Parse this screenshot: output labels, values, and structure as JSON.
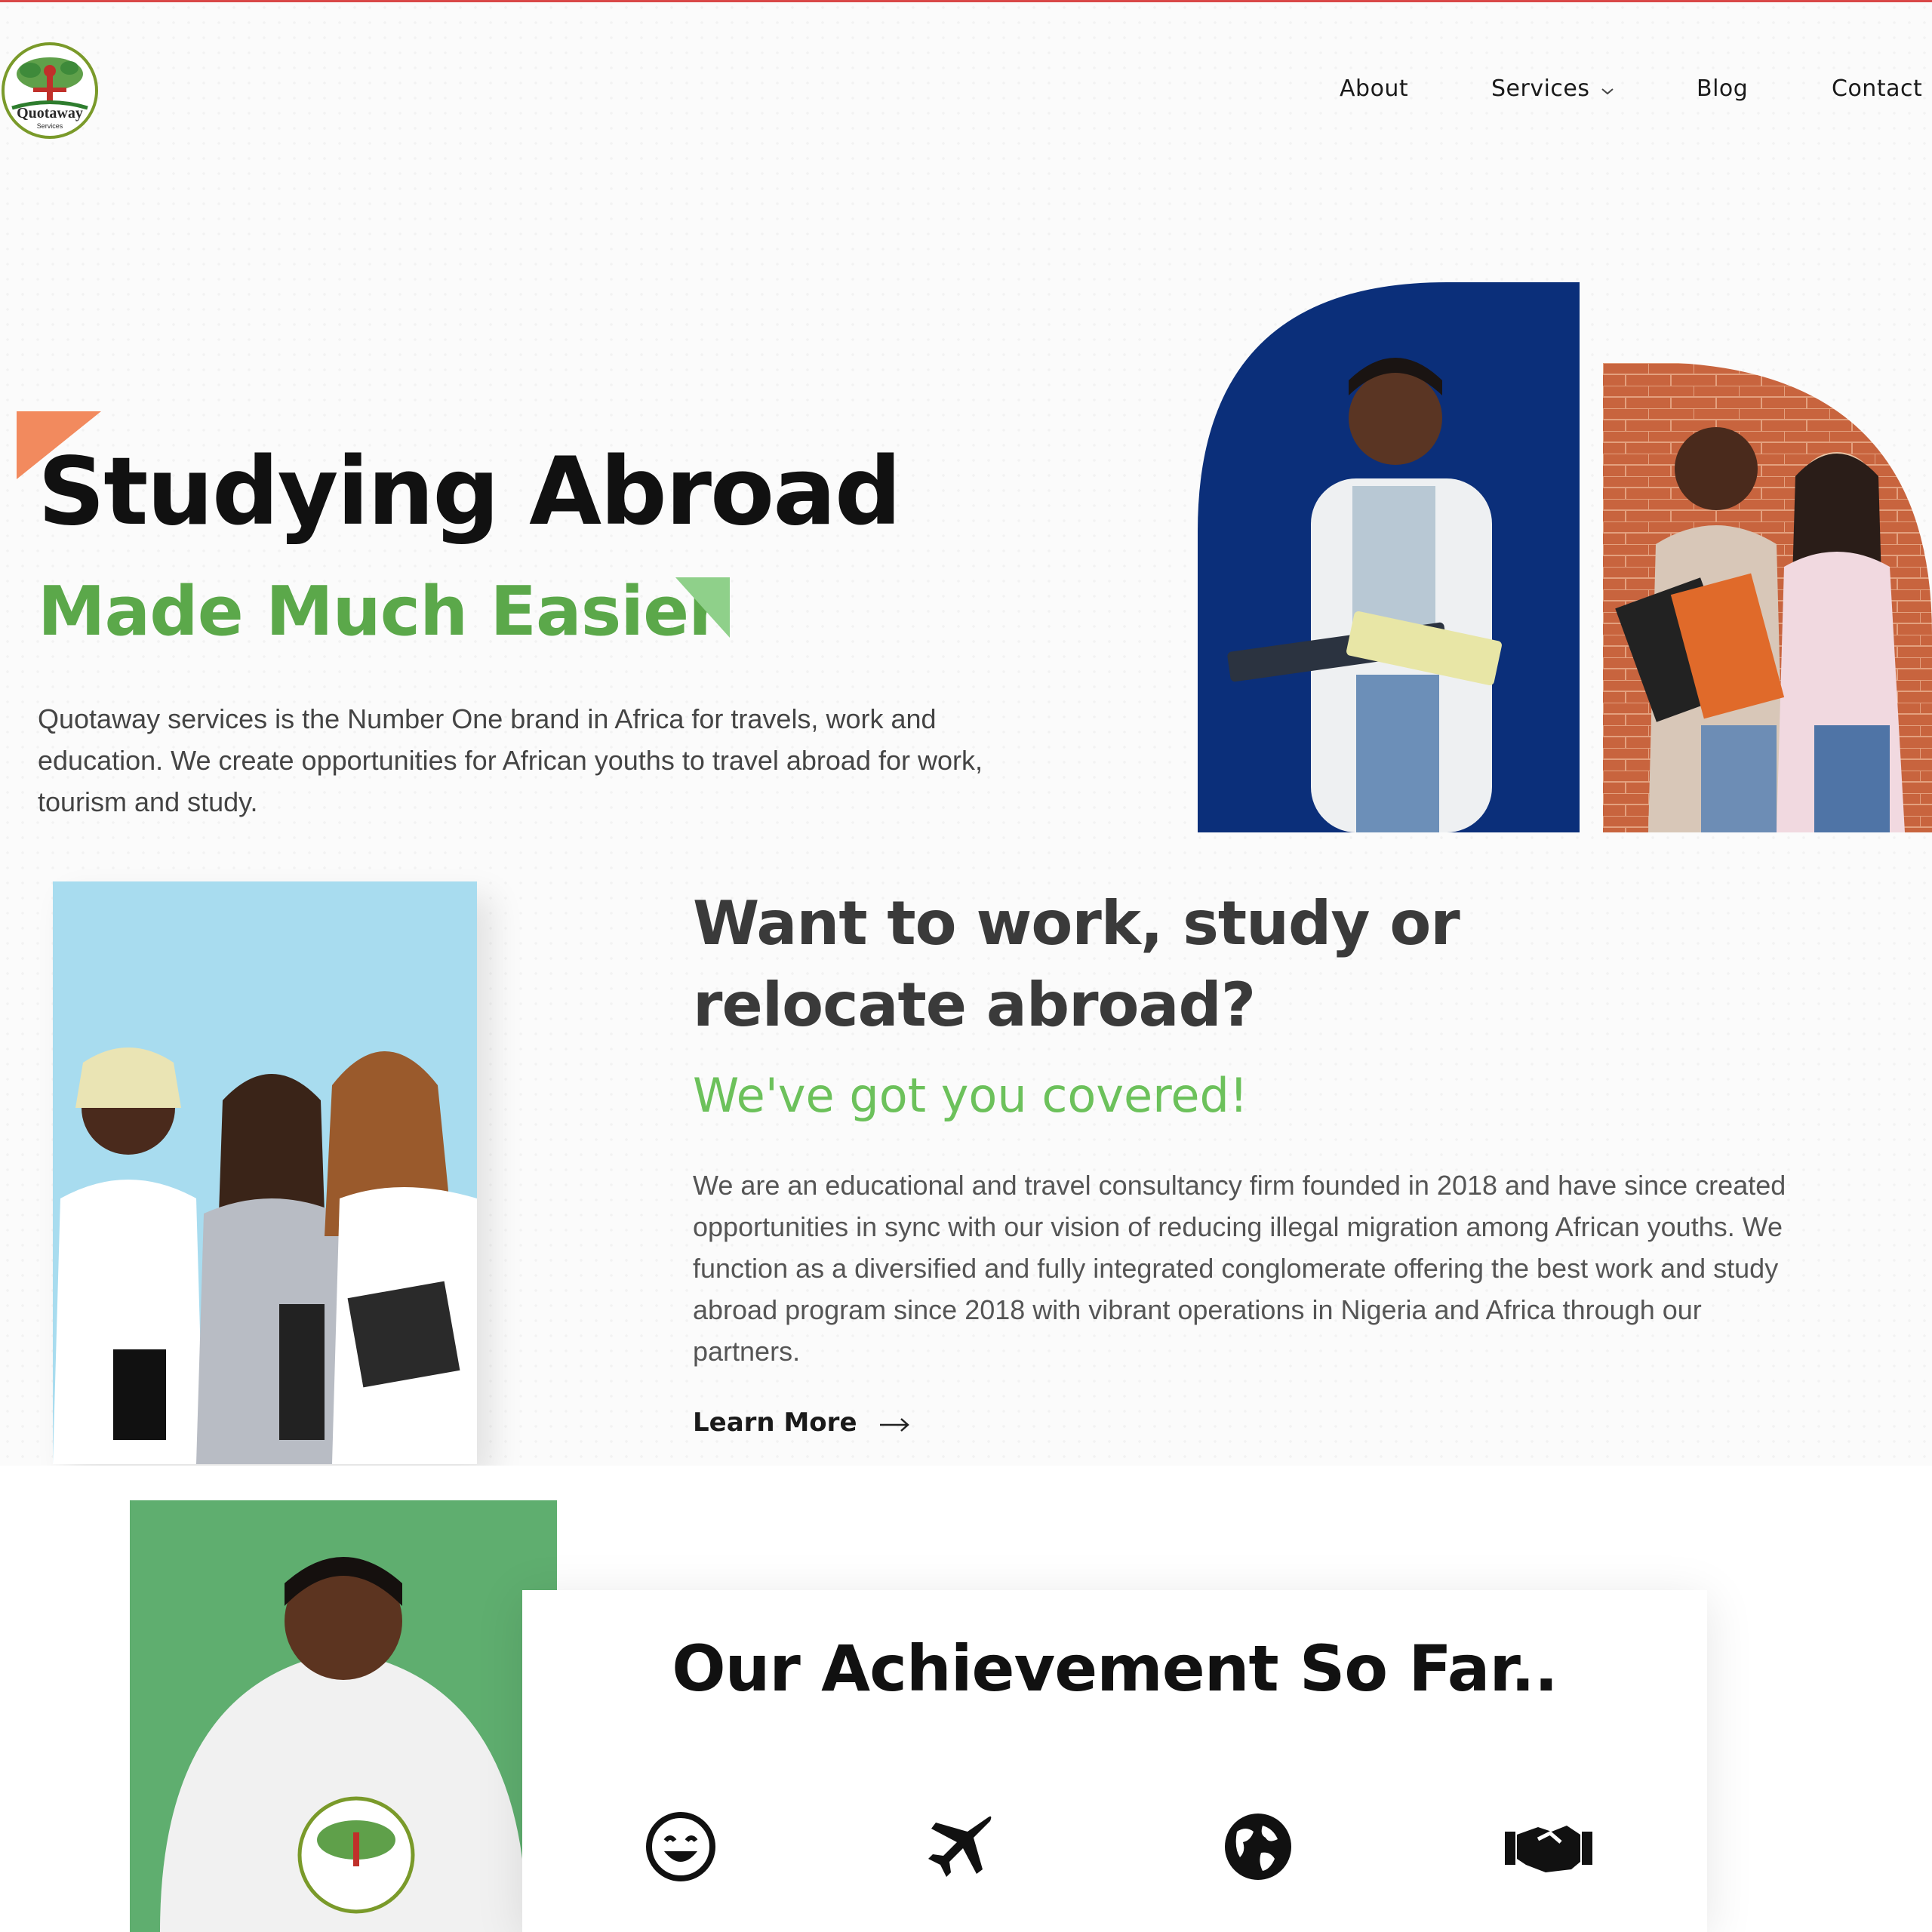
{
  "header": {
    "logo_text": "Quotaway",
    "logo_subtext": "Services",
    "nav": [
      {
        "label": "About"
      },
      {
        "label": "Services"
      },
      {
        "label": "Blog"
      },
      {
        "label": "Contact"
      }
    ]
  },
  "hero": {
    "title": "Studying Abroad",
    "subtitle": "Made Much Easier",
    "description": "Quotaway services is the Number One brand in Africa for travels, work and education. We create opportunities for African youths to travel abroad for work, tourism and study."
  },
  "about": {
    "title": "Want to work, study or relocate abroad?",
    "tagline": "We've got you covered!",
    "description": "We are an educational and travel consultancy firm founded in 2018 and have since created opportunities in sync with our vision of reducing illegal migration among African youths. We function as a diversified and fully integrated conglomerate offering the best work and study abroad program since 2018 with vibrant operations in Nigeria and Africa through our partners.",
    "cta_label": "Learn More"
  },
  "achievements": {
    "title": "Our Achievement So Far..",
    "icons": [
      "smile-icon",
      "airplane-icon",
      "globe-icon",
      "handshake-icon"
    ]
  },
  "colors": {
    "brand_green": "#5ba84a",
    "light_green": "#6cc15b",
    "accent_orange": "#f28a5e",
    "hero_blue": "#0b2f7a"
  }
}
